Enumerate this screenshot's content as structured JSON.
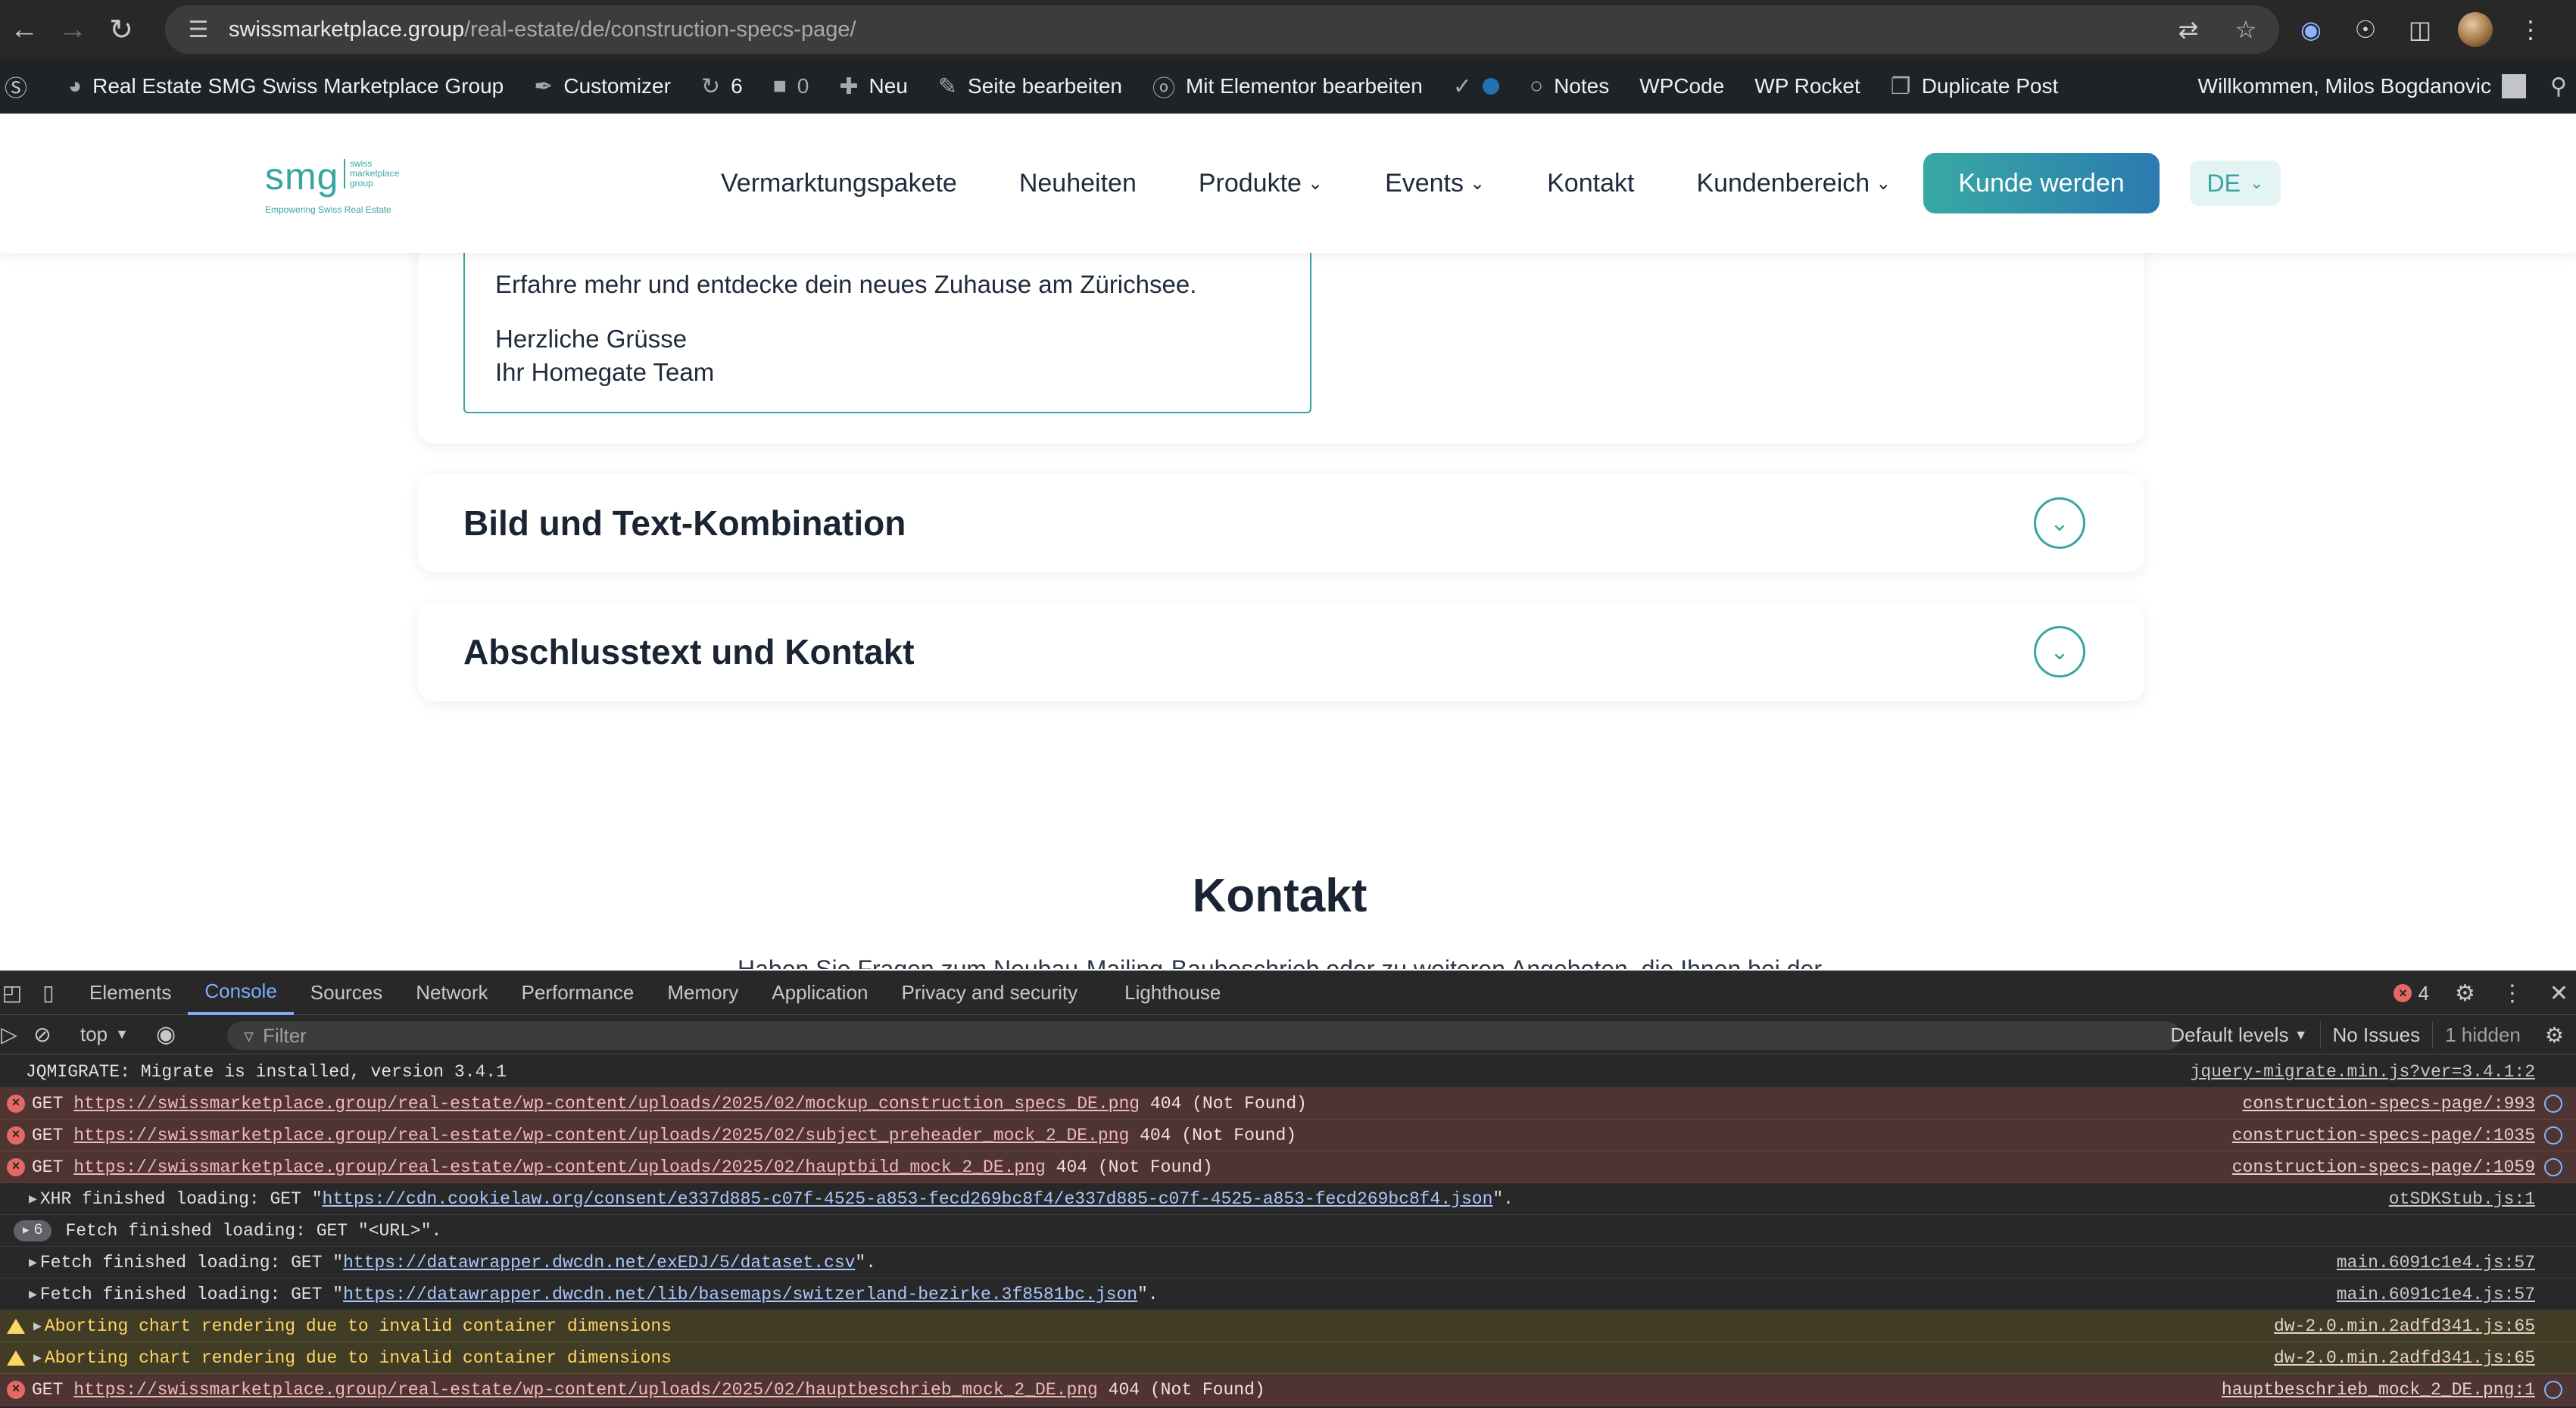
{
  "browser": {
    "url_host": "swissmarketplace.group",
    "url_path": "/real-estate/de/construction-specs-page/"
  },
  "admin_bar": {
    "site_name": "Real Estate SMG Swiss Marketplace Group",
    "customizer": "Customizer",
    "updates_count": "6",
    "comments_count": "0",
    "new": "Neu",
    "edit_page": "Seite bearbeiten",
    "elementor": "Mit Elementor bearbeiten",
    "notes": "Notes",
    "wpcode": "WPCode",
    "wprocket": "WP Rocket",
    "duplicate": "Duplicate Post",
    "welcome": "Willkommen, Milos Bogdanovic"
  },
  "site": {
    "logo_text": "smg",
    "logo_sub": "swiss marketplace group",
    "logo_tagline": "Empowering Swiss Real Estate",
    "nav": [
      {
        "label": "Vermarktungspakete"
      },
      {
        "label": "Neuheiten"
      },
      {
        "label": "Produkte"
      },
      {
        "label": "Events"
      },
      {
        "label": "Kontakt"
      },
      {
        "label": "Kundenbereich"
      }
    ],
    "cta": "Kunde werden",
    "lang": "DE"
  },
  "content": {
    "email_lines": [
      "Erfahre mehr und entdecke dein neues Zuhause am Zürichsee.",
      "Herzliche Grüsse",
      "Ihr Homegate Team"
    ],
    "accordion": [
      {
        "title": "Bild und Text-Kombination"
      },
      {
        "title": "Abschlusstext und Kontakt"
      }
    ],
    "contact_title": "Kontakt",
    "contact_sub": "Haben Sie Fragen zum Neubau-Mailing-Baubeschrieb oder zu weiteren Angeboten, die Ihnen bei der"
  },
  "devtools": {
    "tabs": [
      "Elements",
      "Console",
      "Sources",
      "Network",
      "Performance",
      "Memory",
      "Application",
      "Privacy and security",
      "Lighthouse"
    ],
    "error_count": "4",
    "context": "top",
    "filter_placeholder": "Filter",
    "levels": "Default levels",
    "issues": "No Issues",
    "hidden": "1 hidden",
    "rows": [
      {
        "text": "JQMIGRATE: Migrate is installed, version 3.4.1",
        "source": "jquery-migrate.min.js?ver=3.4.1:2"
      },
      {
        "method": "GET",
        "url": "https://swissmarketplace.group/real-estate/wp-content/uploads/2025/02/mockup_construction_specs_DE.png",
        "status": "404 (Not Found)",
        "source": "construction-specs-page/:993"
      },
      {
        "method": "GET",
        "url": "https://swissmarketplace.group/real-estate/wp-content/uploads/2025/02/subject_preheader_mock_2_DE.png",
        "status": "404 (Not Found)",
        "source": "construction-specs-page/:1035"
      },
      {
        "method": "GET",
        "url": "https://swissmarketplace.group/real-estate/wp-content/uploads/2025/02/hauptbild_mock_2_DE.png",
        "status": "404 (Not Found)",
        "source": "construction-specs-page/:1059"
      },
      {
        "prefix": "XHR finished loading: GET \"",
        "url": "https://cdn.cookielaw.org/consent/e337d885-c07f-4525-a853-fecd269bc8f4/e337d885-c07f-4525-a853-fecd269bc8f4.json",
        "suffix": "\".",
        "source": "otSDKStub.js:1"
      },
      {
        "group_count": "6",
        "text": "Fetch finished loading: GET \"<URL>\"."
      },
      {
        "prefix": "Fetch finished loading: GET \"",
        "url": "https://datawrapper.dwcdn.net/exEDJ/5/dataset.csv",
        "suffix": "\".",
        "source": "main.6091c1e4.js:57"
      },
      {
        "prefix": "Fetch finished loading: GET \"",
        "url": "https://datawrapper.dwcdn.net/lib/basemaps/switzerland-bezirke.3f8581bc.json",
        "suffix": "\".",
        "source": "main.6091c1e4.js:57"
      },
      {
        "text": "Aborting chart rendering due to invalid container dimensions",
        "source": "dw-2.0.min.2adfd341.js:65"
      },
      {
        "text": "Aborting chart rendering due to invalid container dimensions",
        "source": "dw-2.0.min.2adfd341.js:65"
      },
      {
        "method": "GET",
        "url": "https://swissmarketplace.group/real-estate/wp-content/uploads/2025/02/hauptbeschrieb_mock_2_DE.png",
        "status": "404 (Not Found)",
        "source": "hauptbeschrieb_mock_2_DE.png:1"
      }
    ]
  }
}
